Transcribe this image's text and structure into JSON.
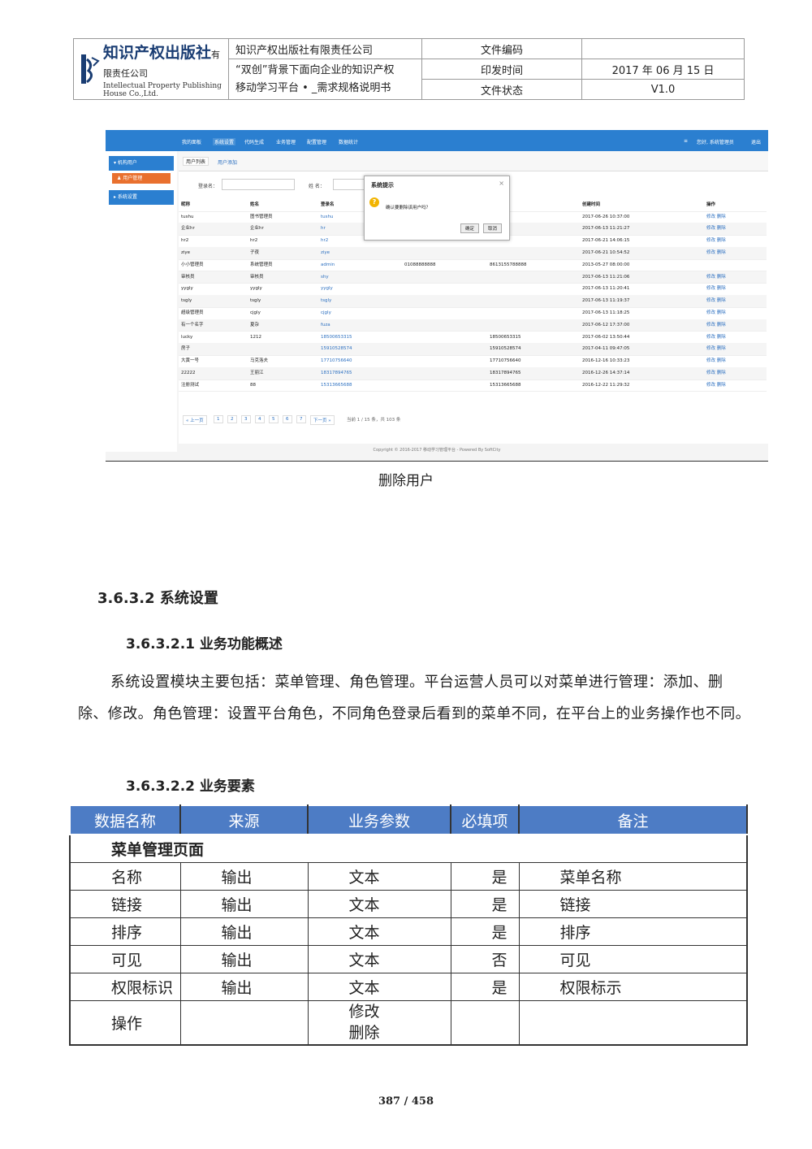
{
  "header": {
    "logo_title": "知识产权出版社",
    "logo_suffix": "有限责任公司",
    "logo_sub": "Intellectual Property Publishing House Co.,Ltd.",
    "company": "知识产权出版社有限责任公司",
    "doc_title_line1": "“双创”背景下面向企业的知识产权",
    "doc_title_line2": "移动学习平台 • _需求规格说明书",
    "label_code": "文件编码",
    "label_date": "印发时间",
    "label_status": "文件状态",
    "code_value": "",
    "date_value": "2017 年 06 月 15 日",
    "status_value": "V1.0"
  },
  "screenshot": {
    "nav": [
      "我的面板",
      "系统设置",
      "代码生成",
      "业务管理",
      "配置管理",
      "数据统计"
    ],
    "greeting": "您好, 系统管理员",
    "logout": "退出",
    "side_menu1": "机构用户",
    "side_sub": "用户管理",
    "side_menu2": "系统设置",
    "tab1": "用户列表",
    "tab2": "用户添加",
    "filter_login": "登录名：",
    "filter_name": "姓 名：",
    "columns": [
      "昵称",
      "姓名",
      "登录名",
      "",
      "",
      "创建时间",
      "操作"
    ],
    "rows": [
      [
        "tushu",
        "图书管理员",
        "tushu",
        "",
        "",
        "2017-06-26 10:37:00",
        "修改 删除"
      ],
      [
        "企业hr",
        "企业hr",
        "hr",
        "",
        "",
        "2017-06-13 11:21:27",
        "修改 删除"
      ],
      [
        "hr2",
        "hr2",
        "hr2",
        "",
        "",
        "2017-06-21 14:06:15",
        "修改 删除"
      ],
      [
        "ziye",
        "子夜",
        "ziye",
        "",
        "",
        "2017-06-21 10:54:52",
        "修改 删除"
      ],
      [
        "小小管理员",
        "系统管理员",
        "admin",
        "01088888888",
        "8613155788888",
        "2013-05-27 08:00:00",
        ""
      ],
      [
        "审核员",
        "审核员",
        "shy",
        "",
        "",
        "2017-06-13 11:21:06",
        "修改 删除"
      ],
      [
        "yygly",
        "yygly",
        "yygly",
        "",
        "",
        "2017-06-13 11:20:41",
        "修改 删除"
      ],
      [
        "tsgly",
        "tsgly",
        "tsgly",
        "",
        "",
        "2017-06-13 11:19:37",
        "修改 删除"
      ],
      [
        "超级管理员",
        "cjgly",
        "cjgly",
        "",
        "",
        "2017-06-13 11:18:25",
        "修改 删除"
      ],
      [
        "有一个名字",
        "夏杂",
        "fuza",
        "",
        "",
        "2017-06-12 17:37:00",
        "修改 删除"
      ],
      [
        "lucky",
        "1212",
        "18500653315",
        "",
        "18500653315",
        "2017-06-02 13:50:44",
        "修改 删除"
      ],
      [
        "房子",
        "",
        "15910528574",
        "",
        "15910528574",
        "2017-04-11 09:47:05",
        "修改 删除"
      ],
      [
        "大黄一号",
        "马克洛夫",
        "17710756640",
        "",
        "17710756640",
        "2016-12-16 10:33:23",
        "修改 删除"
      ],
      [
        "22222",
        "王丽江",
        "18317894765",
        "",
        "18317894765",
        "2016-12-26 14:37:14",
        "修改 删除"
      ],
      [
        "注册测试",
        "88",
        "15313665688",
        "",
        "15313665688",
        "2016-12-22 11:29:32",
        "修改 删除"
      ]
    ],
    "pager": [
      "« 上一页",
      "1",
      "2",
      "3",
      "4",
      "5",
      "6",
      "7",
      "下一页 »"
    ],
    "pager_info": "当前 1 / 15 条，共 103 条",
    "dialog_title": "系统提示",
    "dialog_close": "×",
    "dialog_msg": "确认要删除该用户吗？",
    "dialog_ok": "确定",
    "dialog_cancel": "取消",
    "copyright": "Copyright © 2016-2017 移动学习管理平台 - Powered By SoftCity"
  },
  "caption": "删除用户",
  "h_332": "3.6.3.2 系统设置",
  "h_3321": "3.6.3.2.1 业务功能概述",
  "paragraph": "系统设置模块主要包括：菜单管理、角色管理。平台运营人员可以对菜单进行管理：添加、删除、修改。角色管理：设置平台角色，不同角色登录后看到的菜单不同，在平台上的业务操作也不同。",
  "h_3322": "3.6.3.2.2 业务要素",
  "table": {
    "headers": [
      "数据名称",
      "来源",
      "业务参数",
      "必填项",
      "备注"
    ],
    "section": "菜单管理页面",
    "rows": [
      [
        "名称",
        "输出",
        "文本",
        "是",
        "菜单名称"
      ],
      [
        "链接",
        "输出",
        "文本",
        "是",
        "链接"
      ],
      [
        "排序",
        "输出",
        "文本",
        "是",
        "排序"
      ],
      [
        "可见",
        "输出",
        "文本",
        "否",
        "可见"
      ],
      [
        "权限标识",
        "输出",
        "文本",
        "是",
        "权限标示"
      ]
    ],
    "last_row_name": "操作",
    "last_row_param1": "修改",
    "last_row_param2": "删除"
  },
  "page_number": "387 / 458"
}
